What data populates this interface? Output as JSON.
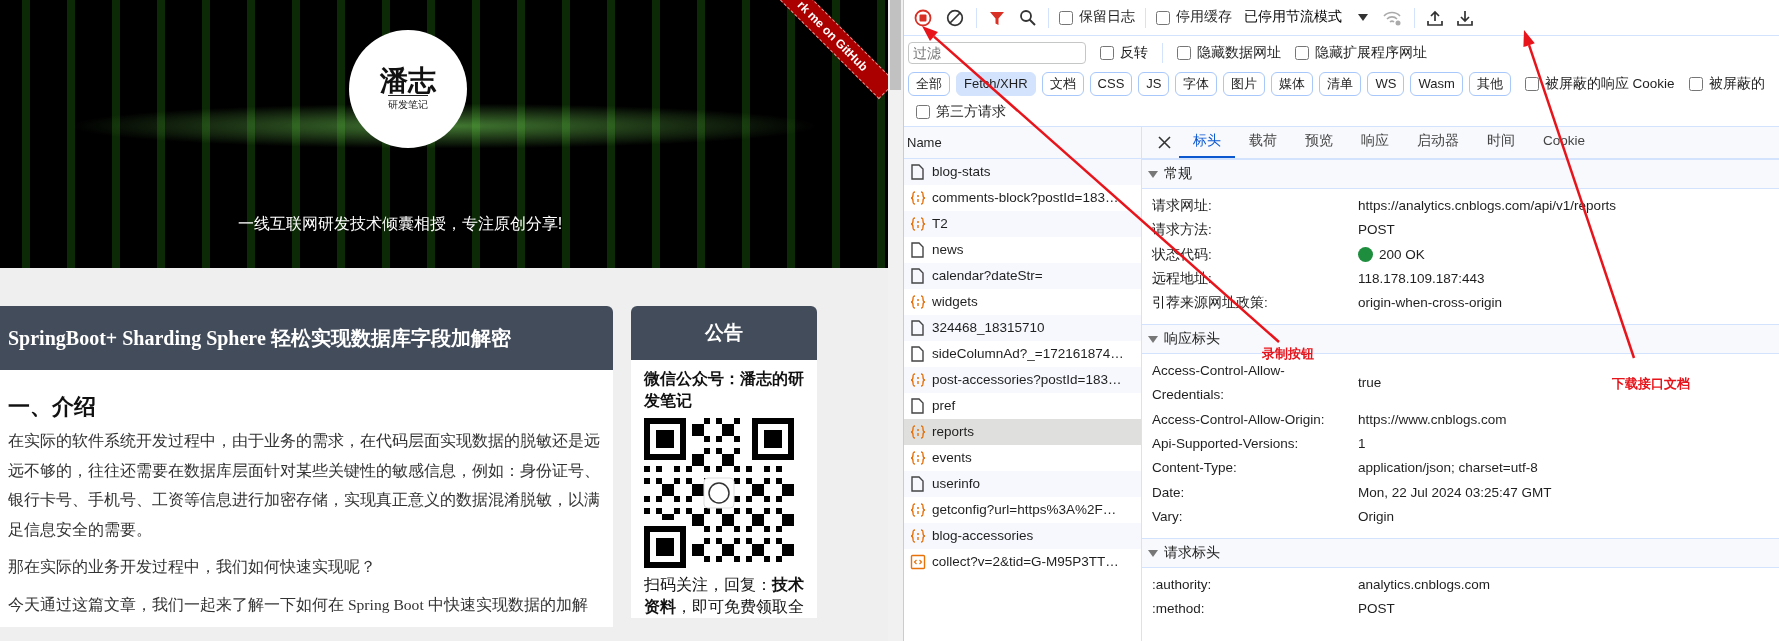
{
  "page": {
    "banner": {
      "logo_text": "潘志",
      "logo_subtext": "研发笔记",
      "slogan": "一线互联网研发技术倾囊相授，专注原创分享!",
      "ribbon": "rk me on GitHub"
    },
    "article": {
      "title": "SpringBoot+ Sharding Sphere 轻松实现数据库字段加解密",
      "heading": "一、介绍",
      "paragraphs": [
        "在实际的软件系统开发过程中，由于业务的需求，在代码层面实现数据的脱敏还是远远不够的，往往还需要在数据库层面针对某些关键性的敏感信息，例如：身份证号、银行卡号、手机号、工资等信息进行加密存储，实现真正意义的数据混淆脱敏，以满足信息安全的需要。",
        "那在实际的业务开发过程中，我们如何快速实现呢？",
        "今天通过这篇文章，我们一起来了解一下如何在 Spring Boot 中快速实现数据的加解"
      ]
    },
    "notice": {
      "title": "公告",
      "text": "微信公众号：潘志的研发笔记",
      "footer": "扫码关注，回复：**技术资料**，即可免费领取全"
    }
  },
  "devtools": {
    "toolbar": {
      "recording": true,
      "filter_active": true,
      "checkboxes": [
        {
          "label": "保留日志",
          "checked": false
        },
        {
          "label": "停用缓存",
          "checked": false
        }
      ],
      "throttling": "已停用节流模式"
    },
    "filter": {
      "placeholder": "过滤",
      "checkboxes": [
        {
          "label": "反转",
          "checked": false
        },
        {
          "label": "隐藏数据网址",
          "checked": false
        },
        {
          "label": "隐藏扩展程序网址",
          "checked": false
        }
      ]
    },
    "types": [
      {
        "label": "全部",
        "selected": false
      },
      {
        "label": "Fetch/XHR",
        "selected": true
      },
      {
        "label": "文档",
        "selected": false
      },
      {
        "label": "CSS",
        "selected": false
      },
      {
        "label": "JS",
        "selected": false
      },
      {
        "label": "字体",
        "selected": false
      },
      {
        "label": "图片",
        "selected": false
      },
      {
        "label": "媒体",
        "selected": false
      },
      {
        "label": "清单",
        "selected": false
      },
      {
        "label": "WS",
        "selected": false
      },
      {
        "label": "Wasm",
        "selected": false
      },
      {
        "label": "其他",
        "selected": false
      }
    ],
    "type_checkboxes": [
      {
        "label": "被屏蔽的响应 Cookie",
        "checked": false
      },
      {
        "label": "被屏蔽的",
        "checked": false
      },
      {
        "label": "第三方请求",
        "checked": false
      }
    ],
    "requests": {
      "column": "Name",
      "rows": [
        {
          "name": "blog-stats",
          "kind": "document",
          "selected": false
        },
        {
          "name": "comments-block?postId=183…",
          "kind": "fetch",
          "selected": false
        },
        {
          "name": "T2",
          "kind": "fetch",
          "selected": false
        },
        {
          "name": "news",
          "kind": "document",
          "selected": false
        },
        {
          "name": "calendar?dateStr=",
          "kind": "document",
          "selected": false
        },
        {
          "name": "widgets",
          "kind": "fetch",
          "selected": false
        },
        {
          "name": "324468_18315710",
          "kind": "document",
          "selected": false
        },
        {
          "name": "sideColumnAd?_=172161874…",
          "kind": "document",
          "selected": false
        },
        {
          "name": "post-accessories?postId=183…",
          "kind": "fetch",
          "selected": false
        },
        {
          "name": "pref",
          "kind": "document",
          "selected": false
        },
        {
          "name": "reports",
          "kind": "fetch",
          "selected": true
        },
        {
          "name": "events",
          "kind": "fetch",
          "selected": false
        },
        {
          "name": "userinfo",
          "kind": "document",
          "selected": false
        },
        {
          "name": "getconfig?url=https%3A%2F…",
          "kind": "fetch",
          "selected": false
        },
        {
          "name": "blog-accessories",
          "kind": "fetch",
          "selected": false
        },
        {
          "name": "collect?v=2&tid=G-M95P3TT…",
          "kind": "ping",
          "selected": false
        }
      ]
    },
    "detail": {
      "tabs": [
        {
          "label": "标头",
          "selected": true
        },
        {
          "label": "载荷",
          "selected": false
        },
        {
          "label": "预览",
          "selected": false
        },
        {
          "label": "响应",
          "selected": false
        },
        {
          "label": "启动器",
          "selected": false
        },
        {
          "label": "时间",
          "selected": false
        },
        {
          "label": "Cookie",
          "selected": false
        }
      ],
      "sections": [
        {
          "title": "常规",
          "expanded": true,
          "rows": [
            {
              "name": "请求网址:",
              "value": "https://analytics.cnblogs.com/api/v1/reports"
            },
            {
              "name": "请求方法:",
              "value": "POST"
            },
            {
              "name": "状态代码:",
              "value": "200 OK",
              "color": "#1e8e3e"
            },
            {
              "name": "远程地址:",
              "value": "118.178.109.187:443"
            },
            {
              "name": "引荐来源网址政策:",
              "value": "origin-when-cross-origin"
            }
          ]
        },
        {
          "title": "响应标头",
          "expanded": true,
          "rows": [
            {
              "name": "Access-Control-Allow-Credentials:",
              "value": "true"
            },
            {
              "name": "Access-Control-Allow-Origin:",
              "value": "https://www.cnblogs.com"
            },
            {
              "name": "Api-Supported-Versions:",
              "value": "1"
            },
            {
              "name": "Content-Type:",
              "value": "application/json; charset=utf-8"
            },
            {
              "name": "Date:",
              "value": "Mon, 22 Jul 2024 03:25:47 GMT"
            },
            {
              "name": "Vary:",
              "value": "Origin"
            }
          ]
        },
        {
          "title": "请求标头",
          "expanded": true,
          "rows": [
            {
              "name": ":authority:",
              "value": "analytics.cnblogs.com"
            },
            {
              "name": ":method:",
              "value": "POST"
            }
          ]
        }
      ]
    }
  },
  "annotations": [
    {
      "text": "录制按钮"
    },
    {
      "text": "下载接口文档"
    }
  ]
}
